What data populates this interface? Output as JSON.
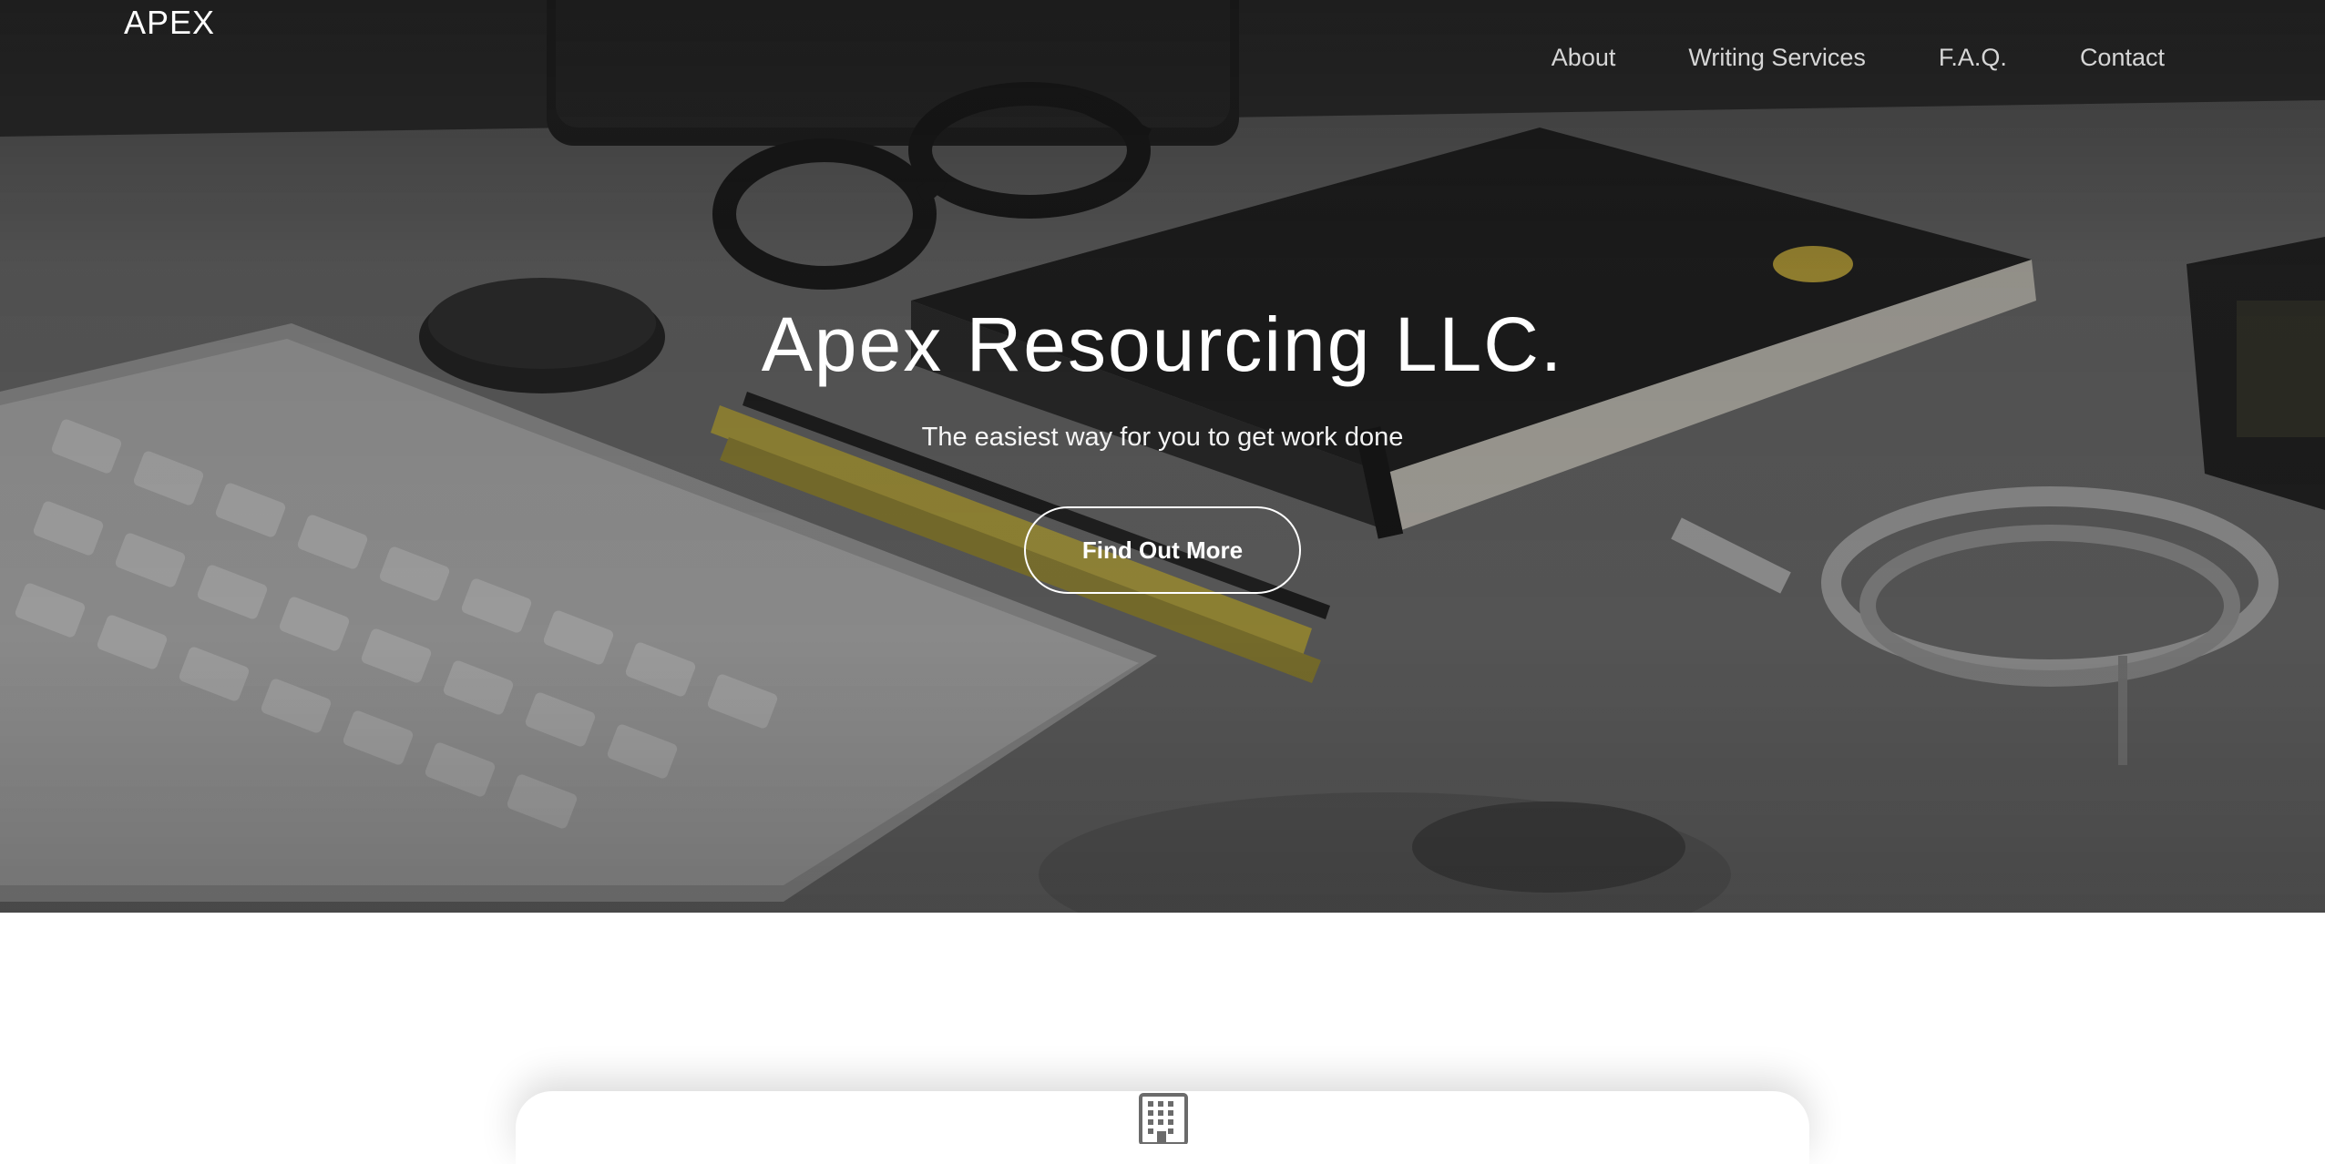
{
  "brand": {
    "name": "APEX"
  },
  "nav": {
    "items": [
      {
        "label": "About"
      },
      {
        "label": "Writing Services"
      },
      {
        "label": "F.A.Q."
      },
      {
        "label": "Contact"
      }
    ]
  },
  "hero": {
    "title": "Apex Resourcing LLC.",
    "subtitle": "The easiest way for you to get work done",
    "cta_label": "Find Out More"
  },
  "services": {
    "icon": "building-icon"
  },
  "colors": {
    "hero_text": "#ffffff",
    "hero_background": "#4f4f4f",
    "page_background": "#ffffff",
    "accent_pencil": "#c9b43c"
  }
}
